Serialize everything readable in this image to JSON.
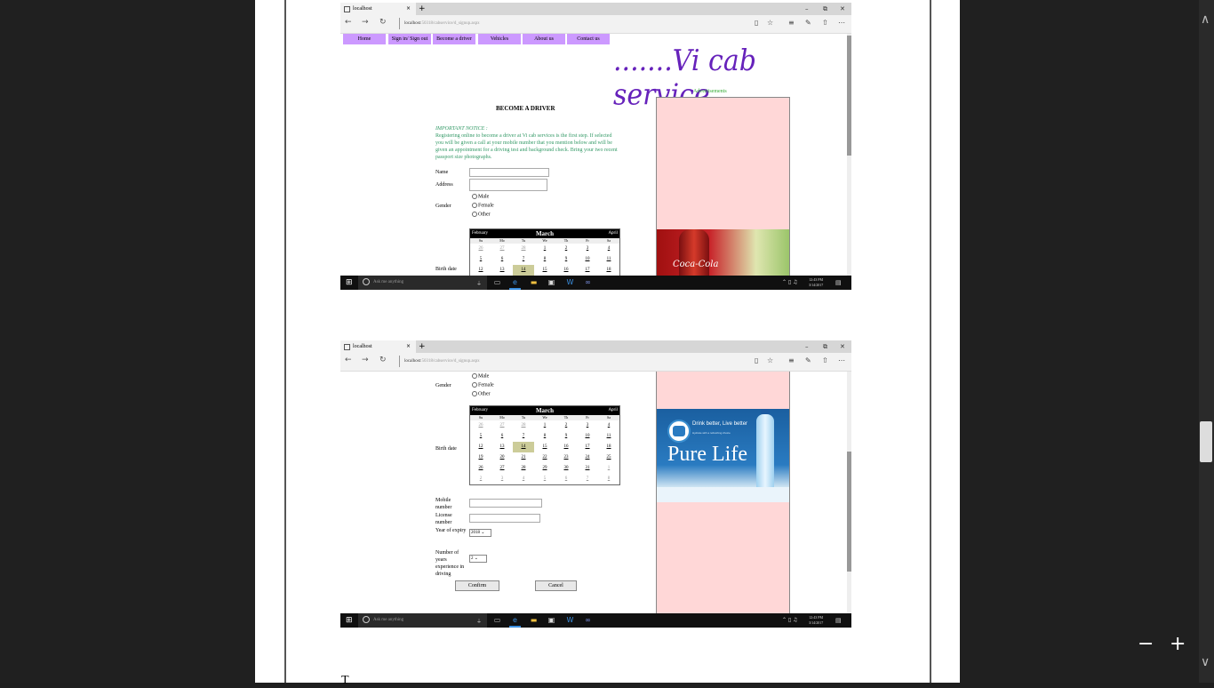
{
  "viewer": {
    "zoom_out_label": "−",
    "zoom_in_label": "+",
    "scroll_up_label": "∧",
    "scroll_down_label": "∨",
    "page_bottom_text": "T",
    "scroll_position_fraction": 0.64
  },
  "browser": {
    "tab_title": "localhost",
    "tab_close": "×",
    "new_tab": "+",
    "min": "–",
    "restore": "⧉",
    "close": "✕",
    "back": "←",
    "forward": "→",
    "refresh": "↻",
    "address_host": "localhost",
    "address_path": ":50318/cabservice/d_signup.aspx"
  },
  "site": {
    "menu": [
      "Home",
      "Sign in/ Sign out",
      "Become a driver",
      "Vehicles",
      "About us",
      "Contact us"
    ],
    "brand": ".......Vi cab service",
    "ads_label": "Advertisements",
    "heading": "BECOME A DRIVER",
    "notice_title": "IMPORTANT NOTICE :",
    "notice_body": "Registering online to become a driver at Vi cab services is the first step. If selected  you will be given a call at your mobile number that you mention below and will be given an appointment for a driving test and background check. Bring your two recent passport size photographs.",
    "labels": {
      "name": "Name",
      "address": "Address",
      "gender": "Gender",
      "birth_date": "Birth date",
      "mobile": "Mobile number",
      "license": "License number",
      "year_expiry": "Year of expiry",
      "years_exp": "Number of years experience in driving"
    },
    "genders": [
      "Male",
      "Female",
      "Other"
    ],
    "year_value": "2018",
    "experience_value": "2",
    "confirm": "Confirm",
    "cancel": "Cancel",
    "ad1_text": "Coca-Cola",
    "ad2_tagline": "Drink better, Live better",
    "ad2_sub": "Hydrate with a refreshing choice",
    "ad2_title": "Pure Life"
  },
  "calendar": {
    "prev": "February",
    "month": "March",
    "next": "April",
    "day_names": [
      "Su",
      "Mo",
      "Tu",
      "We",
      "Th",
      "Fr",
      "Sa"
    ],
    "weeks": [
      [
        "26",
        "27",
        "28",
        "1",
        "2",
        "3",
        "4"
      ],
      [
        "5",
        "6",
        "7",
        "8",
        "9",
        "10",
        "11"
      ],
      [
        "12",
        "13",
        "14",
        "15",
        "16",
        "17",
        "18"
      ],
      [
        "19",
        "20",
        "21",
        "22",
        "23",
        "24",
        "25"
      ],
      [
        "26",
        "27",
        "28",
        "29",
        "30",
        "31",
        "1"
      ],
      [
        "2",
        "3",
        "4",
        "5",
        "6",
        "7",
        "8"
      ]
    ],
    "today": "14"
  },
  "taskbar": {
    "search_placeholder": "Ask me anything",
    "time": "12:43 PM",
    "date": "3/14/2017"
  },
  "colors": {
    "menu_bg": "#cc99ff",
    "brand": "#6622bb",
    "notice": "#339966",
    "ad_bg": "#ffd7d7",
    "calendar_today": "#cccc99"
  }
}
